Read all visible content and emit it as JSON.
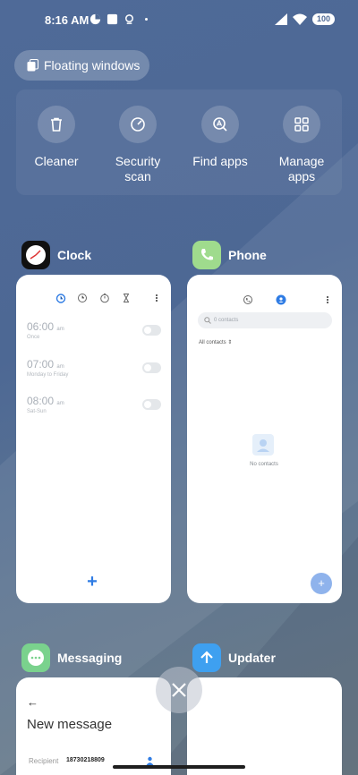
{
  "status": {
    "time": "8:16 AM",
    "battery": "100"
  },
  "floating_windows": "Floating windows",
  "tools": [
    {
      "label": "Cleaner",
      "icon": "trash-icon"
    },
    {
      "label": "Security\nscan",
      "icon": "shield-scan-icon"
    },
    {
      "label": "Find apps",
      "icon": "find-apps-icon"
    },
    {
      "label": "Manage\napps",
      "icon": "grid-icon"
    }
  ],
  "apps": {
    "clock": {
      "name": "Clock",
      "alarms": [
        {
          "time": "06:00",
          "ampm": "am",
          "detail": "Once"
        },
        {
          "time": "07:00",
          "ampm": "am",
          "detail": "Monday to Friday"
        },
        {
          "time": "08:00",
          "ampm": "am",
          "detail": "Sat-Sun"
        }
      ],
      "add": "+"
    },
    "phone": {
      "name": "Phone",
      "search_placeholder": "0 contacts",
      "filter": "All contacts",
      "empty": "No contacts",
      "fab": "+"
    },
    "messaging": {
      "name": "Messaging",
      "title": "New message",
      "recipient_label": "Recipient",
      "recipient": "18730218809",
      "back": "←"
    },
    "updater": {
      "name": "Updater"
    }
  },
  "colors": {
    "accent": "#2f7ce4",
    "phone_green": "#9fdb8d",
    "messaging_green": "#7ad28d",
    "updater_blue": "#3ea0f0"
  }
}
